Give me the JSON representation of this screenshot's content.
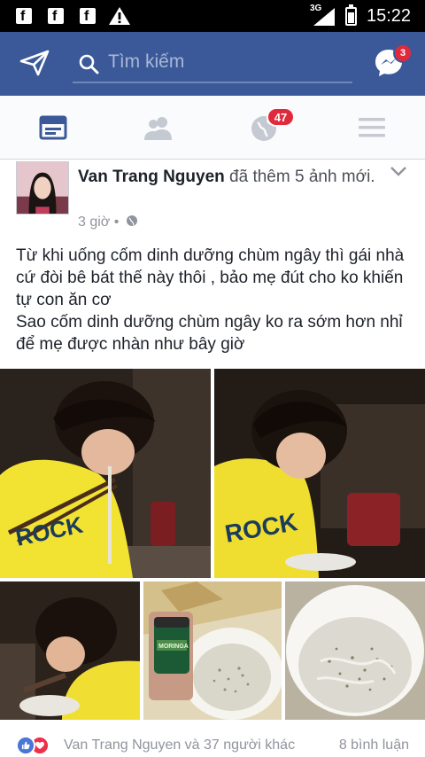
{
  "status_bar": {
    "network": "3G",
    "time": "15:22"
  },
  "header": {
    "search_placeholder": "Tìm kiếm",
    "messenger_badge": "3"
  },
  "tabs": {
    "notifications_badge": "47"
  },
  "post": {
    "author": "Van Trang Nguyen",
    "action": " đã thêm 5 ảnh mới.",
    "time": "3 giờ",
    "separator": " • ",
    "text": "Từ khi uống cốm dinh dưỡng chùm ngây thì gái nhà cứ đòi bê bát thế này thôi , bảo mẹ đút cho ko khiến tự con ăn cơ\nSao cốm dinh dưỡng chùm ngây ko ra sớm hơn nhỉ để mẹ được nhàn như bây giờ",
    "product_label": "MORINGA",
    "reactions_text": "Van Trang Nguyen và 37 người khác",
    "comments_text": "8 bình luận"
  },
  "colors": {
    "fb_blue": "#3b5998",
    "badge_red": "#e02a3c"
  }
}
